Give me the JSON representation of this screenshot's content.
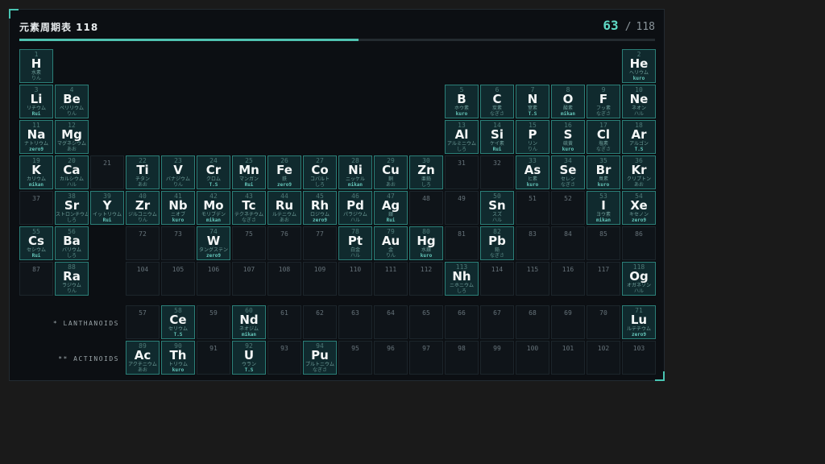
{
  "title": "元素周期表 118",
  "counter": {
    "found": "63",
    "separator": "/",
    "total": "118",
    "progress_percent": 53.4
  },
  "row_labels": {
    "lanthanoids": "* LANTHANOIDS",
    "actinoids": "** ACTINOIDS"
  },
  "main_rows": [
    [
      [
        1,
        "H",
        "水素",
        "りん"
      ],
      [
        "gap",
        16
      ],
      [
        2,
        "He",
        "ヘリウム",
        "kuro"
      ]
    ],
    [
      [
        3,
        "Li",
        "リチウム",
        "Rui"
      ],
      [
        4,
        "Be",
        "ベリリウム",
        "りん"
      ],
      [
        "gap",
        10
      ],
      [
        5,
        "B",
        "ホウ素",
        "kuro"
      ],
      [
        6,
        "C",
        "炭素",
        "なぎさ"
      ],
      [
        7,
        "N",
        "窒素",
        "T.S"
      ],
      [
        8,
        "O",
        "酸素",
        "mikan"
      ],
      [
        9,
        "F",
        "フッ素",
        "なぎさ"
      ],
      [
        10,
        "Ne",
        "ネオン",
        "ハル"
      ]
    ],
    [
      [
        11,
        "Na",
        "ナトリウム",
        "zero9"
      ],
      [
        12,
        "Mg",
        "マグネシウム",
        "あお"
      ],
      [
        "gap",
        10
      ],
      [
        13,
        "Al",
        "アルミニウム",
        "しろ"
      ],
      [
        14,
        "Si",
        "ケイ素",
        "Rui"
      ],
      [
        15,
        "P",
        "リン",
        "りん"
      ],
      [
        16,
        "S",
        "硫黄",
        "kuro"
      ],
      [
        17,
        "Cl",
        "塩素",
        "なぎさ"
      ],
      [
        18,
        "Ar",
        "アルゴン",
        "T.S"
      ]
    ],
    [
      [
        19,
        "K",
        "カリウム",
        "mikan"
      ],
      [
        20,
        "Ca",
        "カルシウム",
        "ハル"
      ],
      [
        21
      ],
      [
        22,
        "Ti",
        "チタン",
        "あお"
      ],
      [
        23,
        "V",
        "バナジウム",
        "りん"
      ],
      [
        24,
        "Cr",
        "クロム",
        "T.S"
      ],
      [
        25,
        "Mn",
        "マンガン",
        "Rui"
      ],
      [
        26,
        "Fe",
        "鉄",
        "zero9"
      ],
      [
        27,
        "Co",
        "コバルト",
        "しろ"
      ],
      [
        28,
        "Ni",
        "ニッケル",
        "mikan"
      ],
      [
        29,
        "Cu",
        "銅",
        "あお"
      ],
      [
        30,
        "Zn",
        "亜鉛",
        "しろ"
      ],
      [
        31
      ],
      [
        32
      ],
      [
        33,
        "As",
        "ヒ素",
        "kuro"
      ],
      [
        34,
        "Se",
        "セレン",
        "なぎさ"
      ],
      [
        35,
        "Br",
        "臭素",
        "kuro"
      ],
      [
        36,
        "Kr",
        "クリプトン",
        "あお"
      ]
    ],
    [
      [
        37
      ],
      [
        38,
        "Sr",
        "ストロンチウム",
        "しろ"
      ],
      [
        39,
        "Y",
        "イットリウム",
        "Rui"
      ],
      [
        40,
        "Zr",
        "ジルコニウム",
        "りん"
      ],
      [
        41,
        "Nb",
        "ニオブ",
        "kuro"
      ],
      [
        42,
        "Mo",
        "モリブデン",
        "mikan"
      ],
      [
        43,
        "Tc",
        "テクネチウム",
        "なぎさ"
      ],
      [
        44,
        "Ru",
        "ルテニウム",
        "あお"
      ],
      [
        45,
        "Rh",
        "ロジウム",
        "zero9"
      ],
      [
        46,
        "Pd",
        "パラジウム",
        "ハル"
      ],
      [
        47,
        "Ag",
        "銀",
        "Rui"
      ],
      [
        48
      ],
      [
        49
      ],
      [
        50,
        "Sn",
        "スズ",
        "ハル"
      ],
      [
        51
      ],
      [
        52
      ],
      [
        53,
        "I",
        "ヨウ素",
        "mikan"
      ],
      [
        54,
        "Xe",
        "キセノン",
        "zero9"
      ]
    ],
    [
      [
        55,
        "Cs",
        "セシウム",
        "Rui"
      ],
      [
        56,
        "Ba",
        "バリウム",
        "しろ"
      ],
      [
        "gap",
        1
      ],
      [
        72
      ],
      [
        73
      ],
      [
        74,
        "W",
        "タングステン",
        "zero9"
      ],
      [
        75
      ],
      [
        76
      ],
      [
        77
      ],
      [
        78,
        "Pt",
        "白金",
        "ハル"
      ],
      [
        79,
        "Au",
        "金",
        "りん"
      ],
      [
        80,
        "Hg",
        "水銀",
        "kuro"
      ],
      [
        81
      ],
      [
        82,
        "Pb",
        "鉛",
        "なぎさ"
      ],
      [
        83
      ],
      [
        84
      ],
      [
        85
      ],
      [
        86
      ]
    ],
    [
      [
        87
      ],
      [
        88,
        "Ra",
        "ラジウム",
        "りん"
      ],
      [
        "gap",
        1
      ],
      [
        104
      ],
      [
        105
      ],
      [
        106
      ],
      [
        107
      ],
      [
        108
      ],
      [
        109
      ],
      [
        110
      ],
      [
        111
      ],
      [
        112
      ],
      [
        113,
        "Nh",
        "ニホニウム",
        "しろ"
      ],
      [
        114
      ],
      [
        115
      ],
      [
        116
      ],
      [
        117
      ],
      [
        118,
        "Og",
        "オガネソン",
        "ハル"
      ]
    ]
  ],
  "lanthanoids": [
    [
      57
    ],
    [
      58,
      "Ce",
      "セリウム",
      "T.S"
    ],
    [
      59
    ],
    [
      60,
      "Nd",
      "ネオジム",
      "mikan"
    ],
    [
      61
    ],
    [
      62
    ],
    [
      63
    ],
    [
      64
    ],
    [
      65
    ],
    [
      66
    ],
    [
      67
    ],
    [
      68
    ],
    [
      69
    ],
    [
      70
    ],
    [
      71,
      "Lu",
      "ルテチウム",
      "zero9"
    ]
  ],
  "actinoids": [
    [
      89,
      "Ac",
      "アクチニウム",
      "あお"
    ],
    [
      90,
      "Th",
      "トリウム",
      "kuro"
    ],
    [
      91
    ],
    [
      92,
      "U",
      "ウラン",
      "T.S"
    ],
    [
      93
    ],
    [
      94,
      "Pu",
      "プルトニウム",
      "なぎさ"
    ],
    [
      95
    ],
    [
      96
    ],
    [
      97
    ],
    [
      98
    ],
    [
      99
    ],
    [
      100
    ],
    [
      101
    ],
    [
      102
    ],
    [
      103
    ]
  ],
  "accent_color": "#4fc3b1"
}
